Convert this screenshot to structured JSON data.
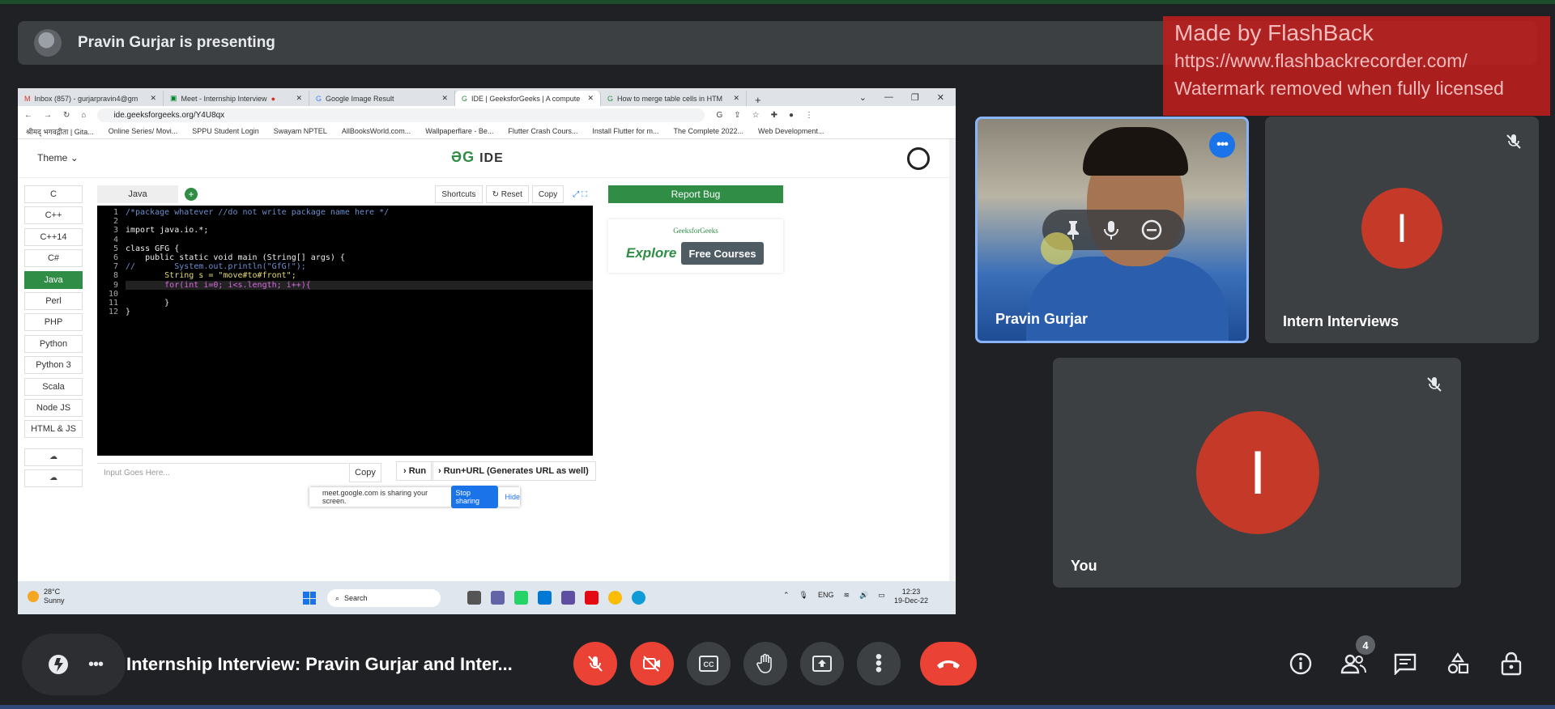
{
  "presenting": {
    "text": "Pravin Gurjar is presenting"
  },
  "watermark": {
    "line1": "Made by FlashBack",
    "line2": "https://www.flashbackrecorder.com/",
    "line3": "Watermark removed when fully licensed"
  },
  "browser": {
    "tabs": [
      {
        "label": "Inbox (857) - gurjarpravin4@gm"
      },
      {
        "label": "Meet - Internship Interview"
      },
      {
        "label": "Google Image Result"
      },
      {
        "label": "IDE | GeeksforGeeks | A compute"
      },
      {
        "label": "How to merge table cells in HTM"
      }
    ],
    "url": "ide.geeksforgeeks.org/Y4U8qx",
    "bookmarks": [
      "श्रीमद् भगवद्गीता | Gita...",
      "Online Series/ Movi...",
      "SPPU Student Login",
      "Swayam NPTEL",
      "AllBooksWorld.com...",
      "Wallpaperflare - Be...",
      "Flutter Crash Cours...",
      "Install Flutter for m...",
      "The Complete 2022...",
      "Web Development..."
    ]
  },
  "ide": {
    "theme_label": "Theme",
    "logo": "IDE",
    "languages": [
      "C",
      "C++",
      "C++14",
      "C#",
      "Java",
      "Perl",
      "PHP",
      "Python",
      "Python 3",
      "Scala",
      "Node JS",
      "HTML & JS"
    ],
    "selected_language": "Java",
    "editor_tab": "Java",
    "shortcuts": "Shortcuts",
    "reset": "Reset",
    "copy": "Copy",
    "report_bug": "Report Bug",
    "promo_brand": "GeeksforGeeks",
    "promo_explore": "Explore",
    "promo_button": "Free Courses",
    "input_placeholder": "Input Goes Here...",
    "copy2": "Copy",
    "run": "Run",
    "run_url": "Run+URL (Generates URL as well)",
    "line_numbers": [
      "1",
      "2",
      "3",
      "4",
      "5",
      "6",
      "7",
      "8",
      "9",
      "10",
      "11",
      "12"
    ],
    "code_lines": [
      "/*package whatever //do not write package name here */",
      "",
      "import java.io.*;",
      "",
      "class GFG {",
      "    public static void main (String[] args) {",
      "//        System.out.println(\"GfG!\");",
      "        String s = \"move#to#front\";",
      "        for(int i=0; i<s.length; i++){",
      "",
      "        }",
      "}"
    ],
    "share_text": "meet.google.com is sharing your screen.",
    "stop_sharing": "Stop sharing",
    "hide": "Hide"
  },
  "taskbar": {
    "temp": "28°C",
    "weather": "Sunny",
    "search": "Search",
    "lang": "ENG",
    "time": "12:23",
    "date": "19-Dec-22"
  },
  "tiles": {
    "pravin": "Pravin Gurjar",
    "intern": "Intern Interviews",
    "intern_initial": "I",
    "you": "You",
    "you_initial": "I"
  },
  "meeting": {
    "title": "Internship Interview: Pravin Gurjar and Inter...",
    "people_count": "4"
  },
  "colors": {
    "accent_blue": "#1a73e8",
    "danger_red": "#ea4335",
    "gfg_green": "#2f8d46",
    "avatar_red": "#c53929"
  }
}
